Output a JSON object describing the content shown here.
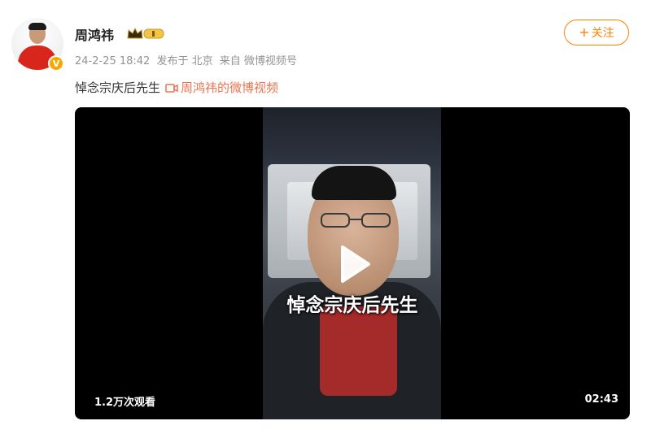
{
  "user": {
    "name": "周鸿祎",
    "verified_badge": "V",
    "avatar_icon": "profile-photo"
  },
  "meta": {
    "date": "24-2-25 18:42",
    "location": "发布于 北京",
    "source": "来自 微博视频号"
  },
  "follow_button": {
    "label": "关注",
    "icon": "plus-icon"
  },
  "post": {
    "text": "悼念宗庆后先生",
    "video_link_label": "周鸿祎的微博视频"
  },
  "video": {
    "caption": "悼念宗庆后先生",
    "views": "1.2万次观看",
    "duration": "02:43"
  },
  "colors": {
    "accent_orange": "#ff8200",
    "link_orange": "#eb7350",
    "badge_gold": "#f7a800"
  }
}
